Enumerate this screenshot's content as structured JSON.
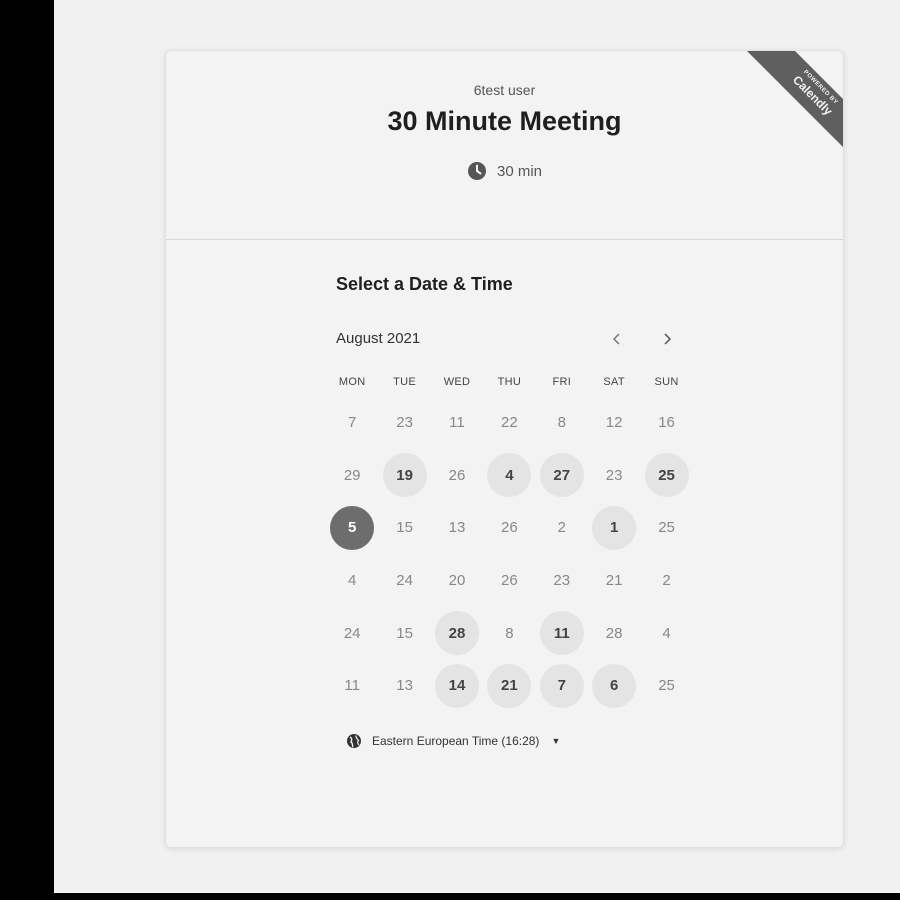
{
  "header": {
    "owner": "6test user",
    "title": "30 Minute Meeting",
    "duration": "30 min",
    "duration_icon": "clock-icon"
  },
  "ribbon": {
    "small": "POWERED BY",
    "big": "Calendly"
  },
  "section_title": "Select a Date & Time",
  "calendar": {
    "month_label": "August 2021",
    "prev_icon": "chevron-left-icon",
    "next_icon": "chevron-right-icon",
    "weekdays": [
      "MON",
      "TUE",
      "WED",
      "THU",
      "FRI",
      "SAT",
      "SUN"
    ],
    "weeks": [
      [
        {
          "d": "7",
          "s": "disabled"
        },
        {
          "d": "23",
          "s": "disabled"
        },
        {
          "d": "11",
          "s": "disabled"
        },
        {
          "d": "22",
          "s": "disabled"
        },
        {
          "d": "8",
          "s": "disabled"
        },
        {
          "d": "12",
          "s": "disabled"
        },
        {
          "d": "16",
          "s": "disabled"
        }
      ],
      [
        {
          "d": "29",
          "s": "disabled"
        },
        {
          "d": "19",
          "s": "available"
        },
        {
          "d": "26",
          "s": "disabled"
        },
        {
          "d": "4",
          "s": "available"
        },
        {
          "d": "27",
          "s": "available"
        },
        {
          "d": "23",
          "s": "disabled"
        },
        {
          "d": "25",
          "s": "available"
        }
      ],
      [
        {
          "d": "5",
          "s": "selected"
        },
        {
          "d": "15",
          "s": "disabled"
        },
        {
          "d": "13",
          "s": "disabled"
        },
        {
          "d": "26",
          "s": "disabled"
        },
        {
          "d": "2",
          "s": "disabled"
        },
        {
          "d": "1",
          "s": "available"
        },
        {
          "d": "25",
          "s": "disabled"
        }
      ],
      [
        {
          "d": "4",
          "s": "disabled"
        },
        {
          "d": "24",
          "s": "disabled"
        },
        {
          "d": "20",
          "s": "disabled"
        },
        {
          "d": "26",
          "s": "disabled"
        },
        {
          "d": "23",
          "s": "disabled"
        },
        {
          "d": "21",
          "s": "disabled"
        },
        {
          "d": "2",
          "s": "disabled"
        }
      ],
      [
        {
          "d": "24",
          "s": "disabled"
        },
        {
          "d": "15",
          "s": "disabled"
        },
        {
          "d": "28",
          "s": "available"
        },
        {
          "d": "8",
          "s": "disabled"
        },
        {
          "d": "11",
          "s": "available"
        },
        {
          "d": "28",
          "s": "disabled"
        },
        {
          "d": "4",
          "s": "disabled"
        }
      ],
      [
        {
          "d": "11",
          "s": "disabled"
        },
        {
          "d": "13",
          "s": "disabled"
        },
        {
          "d": "14",
          "s": "available"
        },
        {
          "d": "21",
          "s": "available"
        },
        {
          "d": "7",
          "s": "available"
        },
        {
          "d": "6",
          "s": "available"
        },
        {
          "d": "25",
          "s": "disabled"
        }
      ]
    ]
  },
  "timezone": {
    "label": "Eastern European Time (16:28)",
    "icon": "globe-icon"
  }
}
